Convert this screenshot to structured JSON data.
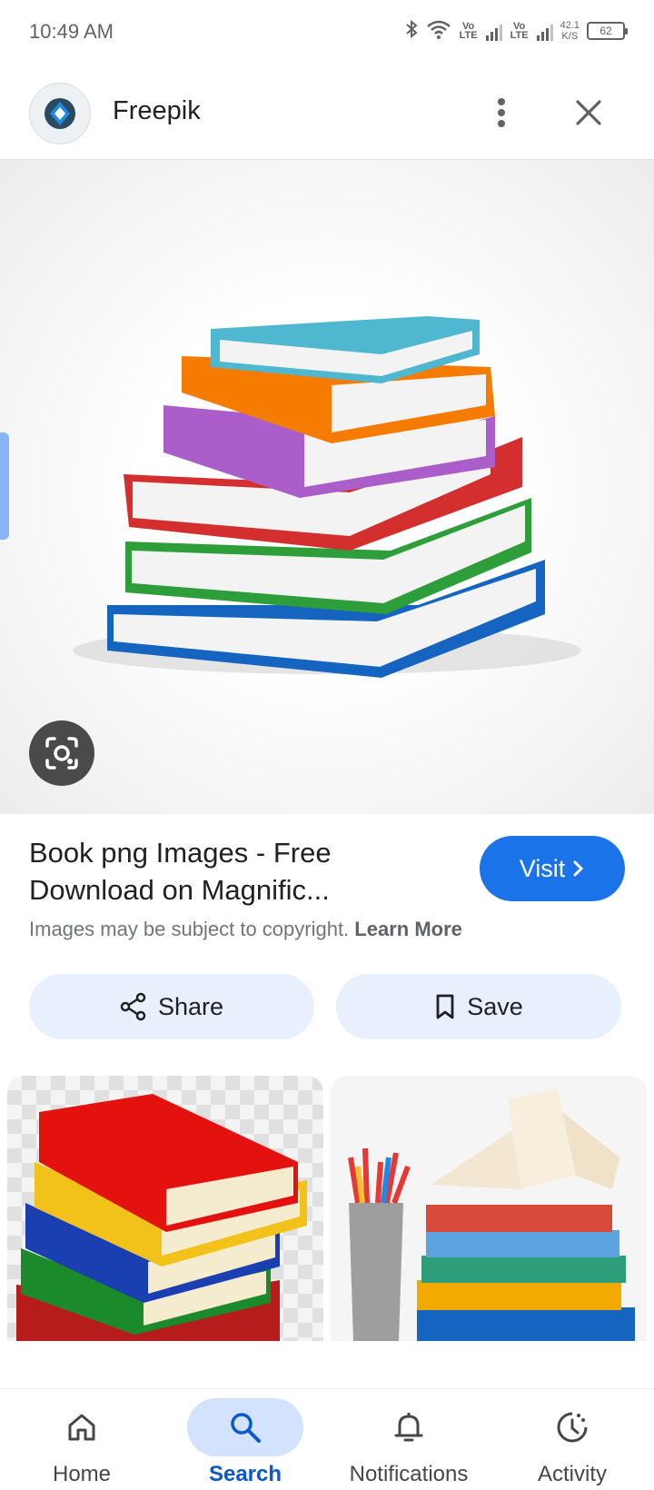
{
  "status_bar": {
    "time": "10:49 AM",
    "volte1": "Vo LTE",
    "volte2": "Vo LTE",
    "speed_value": "42.1",
    "speed_unit": "K/S",
    "battery": "62"
  },
  "header": {
    "site_name": "Freepik"
  },
  "result": {
    "title": "Book png Images - Free Download on Magnific...",
    "visit_label": "Visit",
    "copyright_text": "Images may be subject to copyright.",
    "learn_more": "Learn More"
  },
  "actions": {
    "share_label": "Share",
    "save_label": "Save"
  },
  "bottom_nav": {
    "items": [
      {
        "label": "Home",
        "icon": "home-icon",
        "active": false
      },
      {
        "label": "Search",
        "icon": "search-icon",
        "active": true
      },
      {
        "label": "Notifications",
        "icon": "bell-icon",
        "active": false
      },
      {
        "label": "Activity",
        "icon": "activity-icon",
        "active": false
      }
    ]
  },
  "colors": {
    "accent": "#1a73e8",
    "action_bg": "#e8f0fe",
    "nav_active_pill": "#d3e3fd",
    "nav_active_text": "#0b57d0"
  }
}
